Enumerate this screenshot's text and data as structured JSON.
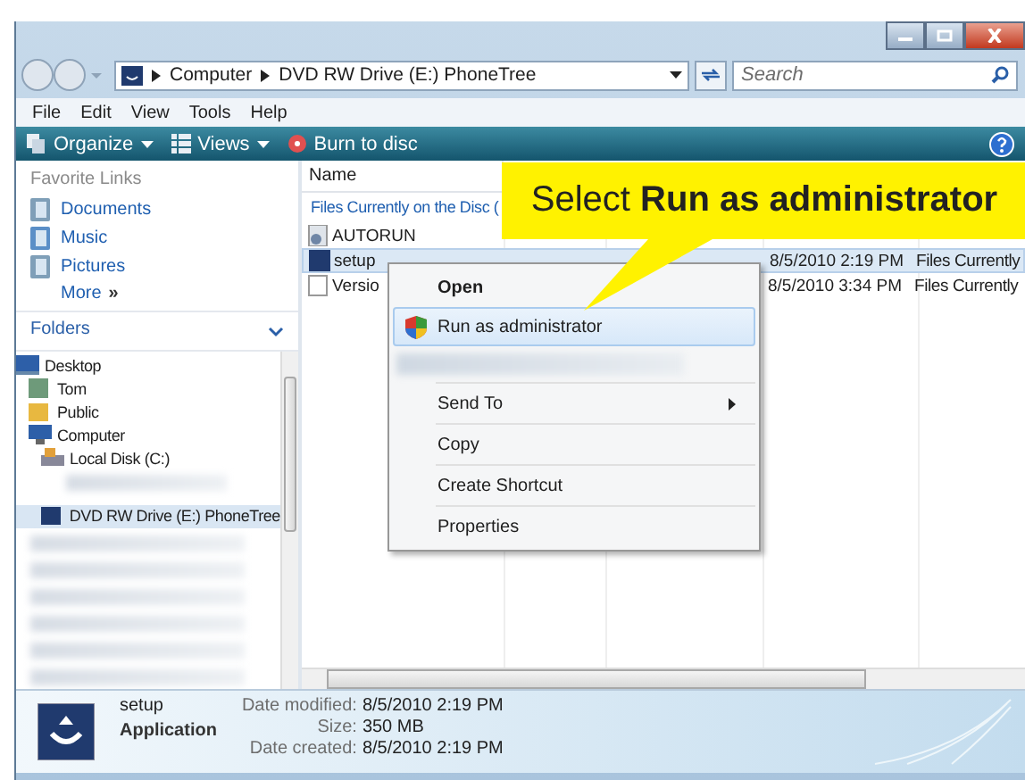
{
  "address": {
    "path": [
      "Computer",
      "DVD RW Drive (E:) PhoneTree"
    ]
  },
  "search": {
    "placeholder": "Search"
  },
  "menu": [
    "File",
    "Edit",
    "View",
    "Tools",
    "Help"
  ],
  "toolbar": [
    {
      "label": "Organize",
      "kind": "organize"
    },
    {
      "label": "Views",
      "kind": "views"
    },
    {
      "label": "Burn to disc",
      "kind": "burn"
    }
  ],
  "favorite_links": {
    "title": "Favorite Links",
    "items": [
      {
        "label": "Documents",
        "kind": "documents"
      },
      {
        "label": "Music",
        "kind": "music"
      },
      {
        "label": "Pictures",
        "kind": "pictures"
      }
    ],
    "more": "More",
    "more_icon": "»"
  },
  "folders": {
    "title": "Folders",
    "tree": [
      {
        "label": "Desktop",
        "kind": "desktop",
        "selected": false,
        "children": [
          {
            "label": "Tom",
            "kind": "user",
            "selected": false
          },
          {
            "label": "Public",
            "kind": "folder",
            "selected": false
          },
          {
            "label": "Computer",
            "kind": "computer",
            "selected": false,
            "children": [
              {
                "label": "Local Disk (C:)",
                "kind": "disk",
                "selected": false
              },
              {
                "kind": "blurred"
              },
              {
                "label": "DVD RW Drive (E:) PhoneTree",
                "kind": "dvd",
                "selected": true
              }
            ]
          }
        ]
      }
    ]
  },
  "file_list": {
    "columns": [
      "Name"
    ],
    "group": "Files Currently on the Disc (",
    "rows": [
      {
        "name": "AUTORUN",
        "kind": "autorun",
        "selected": false
      },
      {
        "name": "setup",
        "kind": "setup",
        "selected": true,
        "date": "8/5/2010 2:19 PM",
        "folder": "Files Currently"
      },
      {
        "name": "Versio",
        "kind": "text",
        "selected": false,
        "date": "8/5/2010 3:34 PM",
        "folder": "Files Currently"
      }
    ]
  },
  "context_menu": {
    "items": [
      {
        "label": "Open",
        "kind": "default",
        "selected": false
      },
      {
        "label": "Run as administrator",
        "kind": "shield",
        "selected": true
      },
      {
        "kind": "blurred"
      },
      {
        "kind": "separator"
      },
      {
        "label": "Send To",
        "kind": "submenu",
        "selected": false
      },
      {
        "kind": "separator"
      },
      {
        "label": "Copy",
        "kind": "plain",
        "selected": false
      },
      {
        "kind": "separator"
      },
      {
        "label": "Create Shortcut",
        "kind": "plain",
        "selected": false
      },
      {
        "kind": "separator"
      },
      {
        "label": "Properties",
        "kind": "plain",
        "selected": false
      }
    ]
  },
  "callout": "Select **Run as administrator**",
  "details": {
    "name": "setup",
    "type": "Application",
    "fields": [
      {
        "label": "Date modified:",
        "value": "8/5/2010 2:19 PM"
      },
      {
        "label": "Size:",
        "value": "350 MB"
      },
      {
        "label": "Date created:",
        "value": "8/5/2010 2:19 PM"
      }
    ]
  }
}
